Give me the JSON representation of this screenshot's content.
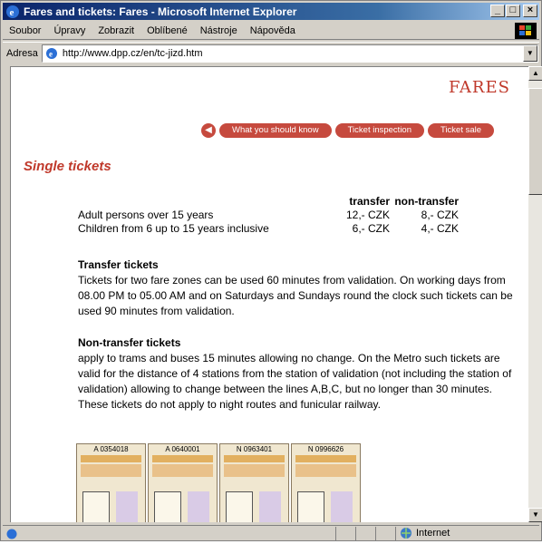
{
  "window": {
    "title": "Fares and tickets: Fares - Microsoft Internet Explorer",
    "controls": {
      "minimize": "_",
      "maximize": "□",
      "close": "×"
    }
  },
  "menu": [
    "Soubor",
    "Úpravy",
    "Zobrazit",
    "Oblíbené",
    "Nástroje",
    "Nápověda"
  ],
  "address": {
    "label": "Adresa",
    "url": "http://www.dpp.cz/en/tc-jizd.htm"
  },
  "page": {
    "logo": "FARES",
    "nav": [
      "What you should know",
      "Ticket inspection",
      "Ticket sale"
    ],
    "heading": "Single tickets",
    "fares": {
      "columns": [
        "transfer",
        "non-transfer"
      ],
      "rows": [
        {
          "label": "Adult persons over 15 years",
          "transfer": "12,- CZK",
          "non_transfer": "8,- CZK"
        },
        {
          "label": "Children from 6 up to 15 years inclusive",
          "transfer": "6,- CZK",
          "non_transfer": "4,- CZK"
        }
      ]
    },
    "transfer": {
      "title": "Transfer tickets",
      "text": "Tickets for two fare zones can be used 60 minutes from validation. On working days from 08.00 PM to 05.00 AM and on Saturdays and Sundays round the clock such tickets can be used 90 minutes from validation."
    },
    "non_transfer": {
      "title": "Non-transfer tickets",
      "text": "apply to trams and buses 15 minutes allowing no change. On the Metro such tickets are valid for the distance of 4 stations from the station of validation (not including the station of validation) allowing to change between the lines A,B,C, but no longer than 30 minutes. These tickets do not apply to night routes and funicular railway."
    },
    "tickets": [
      "A 0354018",
      "A 0640001",
      "N 0963401",
      "N 0996626"
    ]
  },
  "status": {
    "zone": "Internet"
  },
  "colors": {
    "accent": "#c0392b",
    "nav": "#c64a3e",
    "titlebar": "#0a246a"
  }
}
